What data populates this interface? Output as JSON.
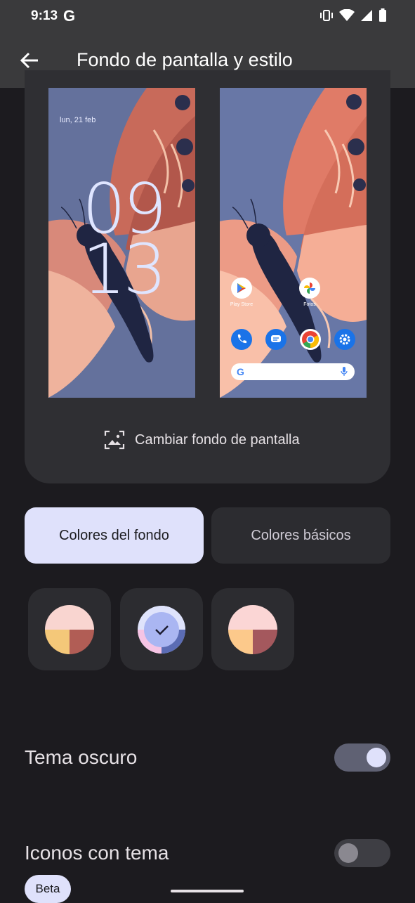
{
  "status_bar": {
    "time": "9:13",
    "google_badge": "G"
  },
  "app_bar": {
    "title": "Fondo de pantalla y estilo"
  },
  "preview": {
    "lock_date": "lun, 21 feb",
    "clock_hours": "09",
    "clock_minutes": "13",
    "apps": [
      {
        "name": "play-store-icon",
        "label": "Play Store"
      },
      {
        "name": "photos-icon",
        "label": "Fotos"
      }
    ],
    "change_wallpaper_label": "Cambiar fondo de pantalla"
  },
  "tabs": [
    {
      "label": "Colores del fondo",
      "selected": true
    },
    {
      "label": "Colores básicos",
      "selected": false
    }
  ],
  "swatches": [
    {
      "colors": [
        "#f9d5d0",
        "#f4c879",
        "#b15d55"
      ],
      "selected": false
    },
    {
      "colors": [
        "#aab6f2",
        "#f6c4e4",
        "#5b6cb4"
      ],
      "selected": true
    },
    {
      "colors": [
        "#fbd6d5",
        "#fcc98b",
        "#a4585d"
      ],
      "selected": false
    }
  ],
  "settings": {
    "dark_theme": {
      "label": "Tema oscuro",
      "on": true
    },
    "themed_icons": {
      "label": "Iconos con tema",
      "on": false,
      "badge": "Beta"
    }
  }
}
